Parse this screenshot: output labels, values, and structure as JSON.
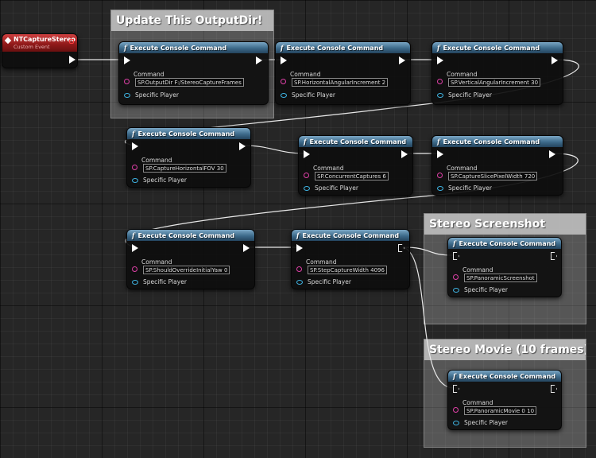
{
  "event": {
    "title": "NTCaptureStereo",
    "subtitle": "Custom Event"
  },
  "comments": [
    {
      "title": "Update This OutputDir!"
    },
    {
      "title": "Stereo Screenshot"
    },
    {
      "title": "Stereo Movie (10 frames)"
    }
  ],
  "nodes": [
    {
      "title": "Execute Console Command",
      "command_label": "Command",
      "command": "SP.OutputDir F:/StereoCaptureFrames",
      "player_label": "Specific Player"
    },
    {
      "title": "Execute Console Command",
      "command_label": "Command",
      "command": "SP.HorizontalAngularIncrement 2",
      "player_label": "Specific Player"
    },
    {
      "title": "Execute Console Command",
      "command_label": "Command",
      "command": "SP.VerticalAngularIncrement 30",
      "player_label": "Specific Player"
    },
    {
      "title": "Execute Console Command",
      "command_label": "Command",
      "command": "SP.CaptureHorizontalFOV 30",
      "player_label": "Specific Player"
    },
    {
      "title": "Execute Console Command",
      "command_label": "Command",
      "command": "SP.ConcurrentCaptures 6",
      "player_label": "Specific Player"
    },
    {
      "title": "Execute Console Command",
      "command_label": "Command",
      "command": "SP.CaptureSlicePixelWidth 720",
      "player_label": "Specific Player"
    },
    {
      "title": "Execute Console Command",
      "command_label": "Command",
      "command": "SP.ShouldOverrideInitialYaw 0",
      "player_label": "Specific Player"
    },
    {
      "title": "Execute Console Command",
      "command_label": "Command",
      "command": "SP.StepCaptureWidth 4096",
      "player_label": "Specific Player"
    },
    {
      "title": "Execute Console Command",
      "command_label": "Command",
      "command": "SP.PanoramicScreenshot",
      "player_label": "Specific Player"
    },
    {
      "title": "Execute Console Command",
      "command_label": "Command",
      "command": "SP.PanoramicMovie 0 10",
      "player_label": "Specific Player"
    }
  ],
  "colors": {
    "function_header": "#3d6a8a",
    "event_header": "#8e1818",
    "exec_wire": "#ffffff",
    "string_pin": "#e040a8",
    "object_pin": "#3fb6e6"
  }
}
